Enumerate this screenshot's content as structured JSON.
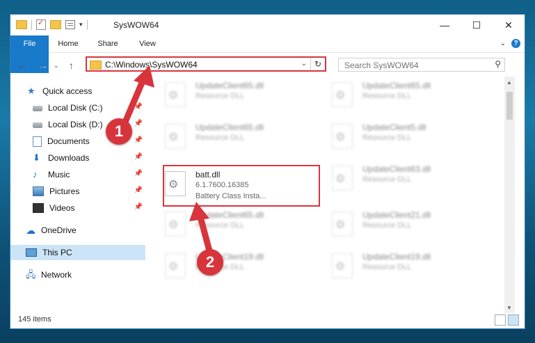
{
  "window": {
    "title": "SysWOW64",
    "minimize": "—",
    "maximize": "☐",
    "close": "✕"
  },
  "ribbon": {
    "file": "File",
    "home": "Home",
    "share": "Share",
    "view": "View",
    "expand": "⌄",
    "help": "?"
  },
  "address": {
    "path": "C:\\Windows\\SysWOW64",
    "search_placeholder": "Search SysWOW64"
  },
  "sidebar": {
    "items": [
      {
        "label": "Quick access",
        "icon": "star-icon"
      },
      {
        "label": "Local Disk (C:)",
        "icon": "disk-icon",
        "pinned": true
      },
      {
        "label": "Local Disk (D:)",
        "icon": "disk-icon",
        "pinned": true
      },
      {
        "label": "Documents",
        "icon": "document-icon",
        "pinned": true
      },
      {
        "label": "Downloads",
        "icon": "download-icon",
        "pinned": true
      },
      {
        "label": "Music",
        "icon": "music-icon",
        "pinned": true
      },
      {
        "label": "Pictures",
        "icon": "picture-icon",
        "pinned": true
      },
      {
        "label": "Videos",
        "icon": "video-icon",
        "pinned": true
      },
      {
        "label": "OneDrive",
        "icon": "cloud-icon"
      },
      {
        "label": "This PC",
        "icon": "computer-icon",
        "selected": true
      },
      {
        "label": "Network",
        "icon": "network-icon"
      }
    ]
  },
  "files": [
    {
      "name": "UpdateClient65.dll",
      "desc": "Resource DLL"
    },
    {
      "name": "UpdateClient65.dll",
      "desc": "Resource DLL"
    },
    {
      "name": "UpdateClient65.dll",
      "desc": "Resource DLL"
    },
    {
      "name": "UpdateClient5.dll",
      "desc": "Resource DLL"
    },
    {
      "name": "batt.dll",
      "desc": "6.1.7600.16385",
      "desc2": "Battery Class Insta..."
    },
    {
      "name": "UpdateClient63.dll",
      "desc": "Resource DLL"
    },
    {
      "name": "UpdateClient65.dll",
      "desc": "Resource DLL"
    },
    {
      "name": "UpdateClient21.dll",
      "desc": "Resource DLL"
    },
    {
      "name": "UpdateClient19.dll",
      "desc": "Resource DLL"
    },
    {
      "name": "UpdateClient19.dll",
      "desc": "Resource DLL"
    }
  ],
  "status": {
    "count": "145 items"
  },
  "callouts": {
    "one": "1",
    "two": "2"
  }
}
